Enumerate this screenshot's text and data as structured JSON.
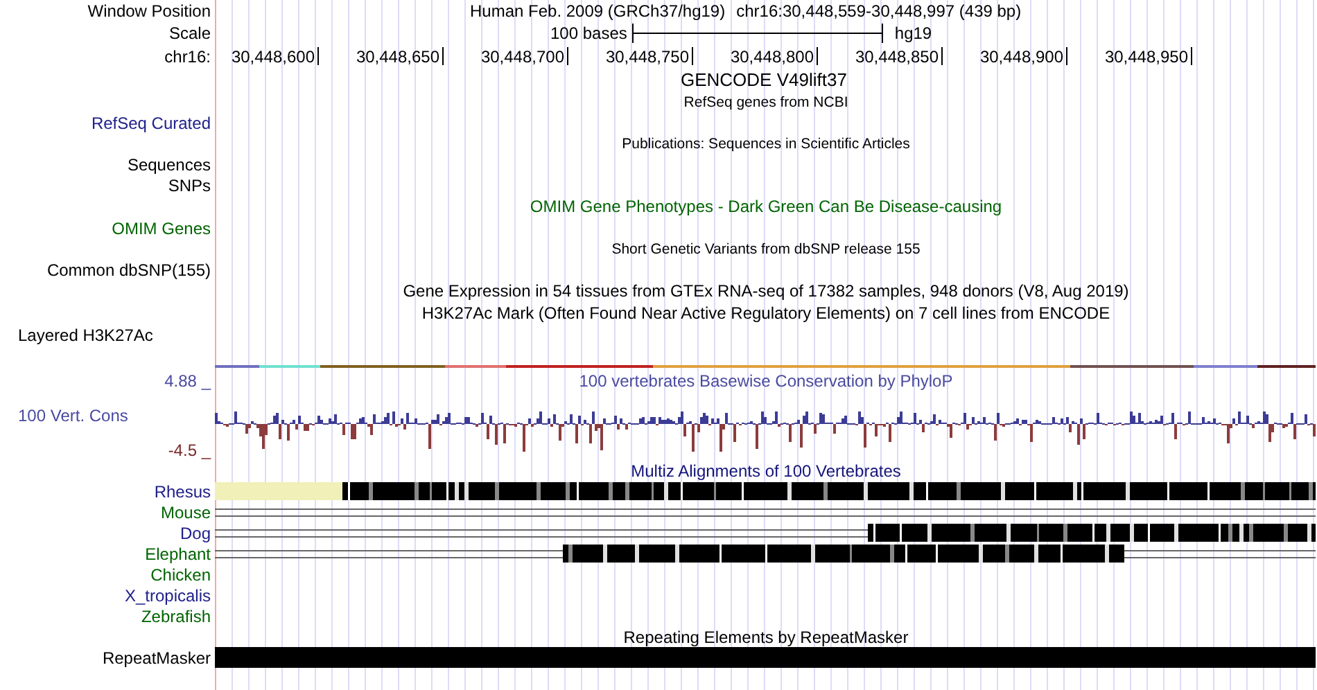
{
  "header": {
    "position_label": "Window Position",
    "assembly_title": "Human Feb. 2009 (GRCh37/hg19)",
    "position": "chr16:30,448,559-30,448,997 (439 bp)",
    "scale_label": "Scale",
    "scale_text": "100 bases",
    "scale_assembly": "hg19",
    "chrom_label": "chr16:",
    "ticks": [
      "30,448,600",
      "30,448,650",
      "30,448,700",
      "30,448,750",
      "30,448,800",
      "30,448,850",
      "30,448,900",
      "30,448,950"
    ]
  },
  "tracks": [
    {
      "kind": "gene",
      "title": "GENCODE V49lift37"
    },
    {
      "kind": "caption",
      "title": "RefSeq genes from NCBI"
    },
    {
      "kind": "label",
      "label": "RefSeq Curated",
      "color": "#20208c"
    },
    {
      "kind": "caption",
      "title": "Publications: Sequences in Scientific Articles"
    },
    {
      "kind": "label",
      "label": "Sequences",
      "color": "#000000"
    },
    {
      "kind": "label",
      "label": "SNPs",
      "color": "#000000"
    },
    {
      "kind": "title",
      "title": "OMIM Gene Phenotypes - Dark Green Can Be Disease-causing",
      "color": "#006400"
    },
    {
      "kind": "label",
      "label": "OMIM Genes",
      "color": "#006400"
    },
    {
      "kind": "caption",
      "title": "Short Genetic Variants from dbSNP release 155"
    },
    {
      "kind": "label",
      "label": "Common dbSNP(155)",
      "color": "#000000"
    },
    {
      "kind": "title",
      "title": "Gene Expression in 54 tissues from GTEx RNA-seq of 17382 samples, 948 donors (V8, Aug 2019)",
      "color": "#000000"
    },
    {
      "kind": "title",
      "title": "H3K27Ac Mark (Often Found Near Active Regulatory Elements) on 7 cell lines from ENCODE",
      "color": "#000000"
    },
    {
      "kind": "layered",
      "label": "Layered H3K27Ac"
    },
    {
      "kind": "conservation",
      "title": "100 vertebrates Basewise Conservation by PhyloP",
      "max_label": "4.88 _",
      "label": "100 Vert. Cons",
      "min_label": "-4.5 _"
    },
    {
      "kind": "multiz",
      "title": "Multiz Alignments of 100 Vertebrates",
      "species": [
        {
          "name": "Rhesus",
          "color": "#20208c"
        },
        {
          "name": "Mouse",
          "color": "#006400"
        },
        {
          "name": "Dog",
          "color": "#20208c"
        },
        {
          "name": "Elephant",
          "color": "#006400"
        },
        {
          "name": "Chicken",
          "color": "#006400"
        },
        {
          "name": "X_tropicalis",
          "color": "#20208c"
        },
        {
          "name": "Zebrafish",
          "color": "#006400"
        }
      ]
    },
    {
      "kind": "repeat",
      "title": "Repeating Elements by RepeatMasker",
      "label": "RepeatMasker"
    }
  ]
}
